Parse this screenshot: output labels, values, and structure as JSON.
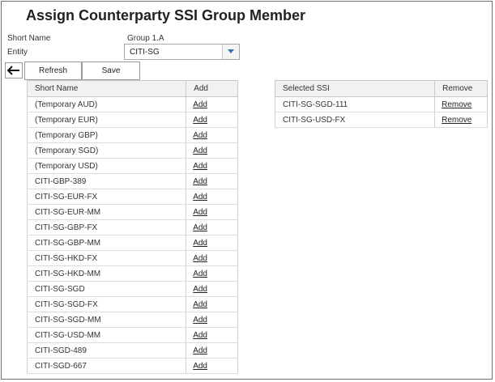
{
  "page": {
    "title": "Assign Counterparty SSI Group Member"
  },
  "form": {
    "short_name_label": "Short Name",
    "short_name_value": "Group 1.A",
    "entity_label": "Entity",
    "entity_value": "CITI-SG"
  },
  "toolbar": {
    "back_icon": "arrow-left-icon",
    "refresh_label": "Refresh",
    "save_label": "Save"
  },
  "available": {
    "columns": [
      "Short Name",
      "Add"
    ],
    "rows": [
      {
        "name": "(Temporary AUD)",
        "action": "Add"
      },
      {
        "name": "(Temporary EUR)",
        "action": "Add"
      },
      {
        "name": "(Temporary GBP)",
        "action": "Add"
      },
      {
        "name": "(Temporary SGD)",
        "action": "Add"
      },
      {
        "name": "(Temporary USD)",
        "action": "Add"
      },
      {
        "name": "CITI-GBP-389",
        "action": "Add"
      },
      {
        "name": "CITI-SG-EUR-FX",
        "action": "Add"
      },
      {
        "name": "CITI-SG-EUR-MM",
        "action": "Add"
      },
      {
        "name": "CITI-SG-GBP-FX",
        "action": "Add"
      },
      {
        "name": "CITI-SG-GBP-MM",
        "action": "Add"
      },
      {
        "name": "CITI-SG-HKD-FX",
        "action": "Add"
      },
      {
        "name": "CITI-SG-HKD-MM",
        "action": "Add"
      },
      {
        "name": "CITI-SG-SGD",
        "action": "Add"
      },
      {
        "name": "CITI-SG-SGD-FX",
        "action": "Add"
      },
      {
        "name": "CITI-SG-SGD-MM",
        "action": "Add"
      },
      {
        "name": "CITI-SG-USD-MM",
        "action": "Add"
      },
      {
        "name": "CITI-SGD-489",
        "action": "Add"
      },
      {
        "name": "CITI-SGD-667",
        "action": "Add"
      }
    ]
  },
  "selected": {
    "columns": [
      "Selected SSI",
      "Remove"
    ],
    "rows": [
      {
        "name": "CITI-SG-SGD-111",
        "action": "Remove"
      },
      {
        "name": "CITI-SG-USD-FX",
        "action": "Remove"
      }
    ]
  }
}
